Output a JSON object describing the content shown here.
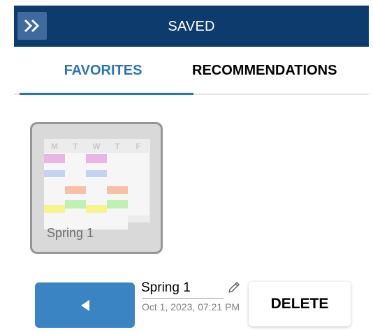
{
  "header": {
    "title": "SAVED",
    "collapse_icon": "double-chevron-right-icon"
  },
  "tabs": [
    {
      "label": "FAVORITES",
      "active": true
    },
    {
      "label": "RECOMMENDATIONS",
      "active": false
    }
  ],
  "favorites": [
    {
      "name": "Spring 1",
      "thumbnail": {
        "days": [
          "M",
          "T",
          "W",
          "T",
          "F"
        ],
        "colors": [
          "#e8b6e3",
          "#c5d2f0",
          "#f6c0a6",
          "#f7f48c",
          "#bff0b4"
        ]
      }
    }
  ],
  "selected": {
    "name": "Spring 1",
    "date": "Oct 1, 2023, 07:21 PM",
    "edit_icon": "pencil-icon",
    "back_icon": "triangle-left-icon",
    "delete_label": "DELETE"
  },
  "colors": {
    "header": "#0d3b6e",
    "accent": "#2b74b9",
    "button": "#3a84c4"
  }
}
